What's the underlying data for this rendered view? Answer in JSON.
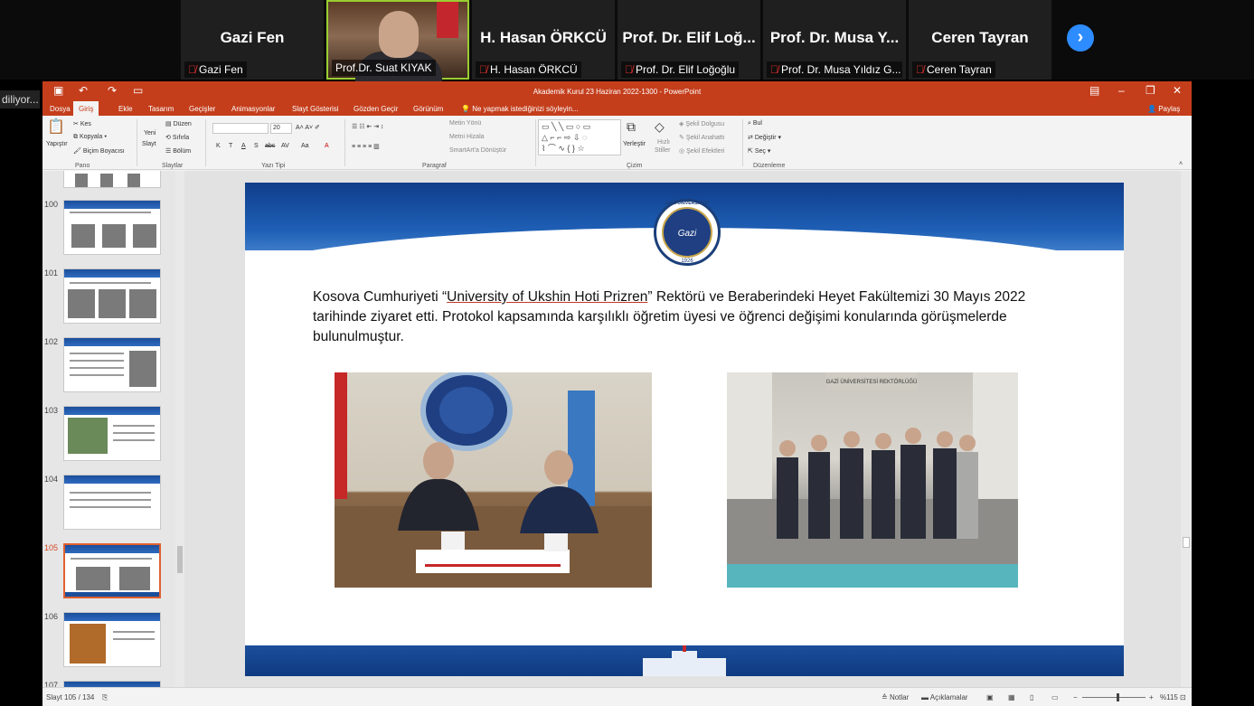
{
  "zoom_meeting": {
    "participants": [
      {
        "tile_name": "Gazi Fen",
        "label": "Gazi Fen",
        "muted": true
      },
      {
        "tile_name": "",
        "label": "Prof.Dr. Suat KIYAK",
        "muted": false,
        "active_speaker": true
      },
      {
        "tile_name": "H. Hasan ÖRKCÜ",
        "label": "H. Hasan ÖRKCÜ",
        "muted": true
      },
      {
        "tile_name": "Prof. Dr. Elif Loğ...",
        "label": "Prof. Dr. Elif Loğoğlu",
        "muted": true
      },
      {
        "tile_name": "Prof. Dr. Musa Y...",
        "label": "Prof. Dr. Musa Yıldız G...",
        "muted": true
      },
      {
        "tile_name": "Ceren Tayran",
        "label": "Ceren Tayran",
        "muted": true
      }
    ],
    "next_icon": "chevron-right-icon",
    "sharing_label": "diliyor..."
  },
  "powerpoint": {
    "window_title": "Akademik Kurul 23 Haziran 2022-1300 - PowerPoint",
    "tabs": [
      "Dosya",
      "Giriş",
      "Ekle",
      "Tasarım",
      "Geçişler",
      "Animasyonlar",
      "Slayt Gösterisi",
      "Gözden Geçir",
      "Görünüm"
    ],
    "active_tab": "Giriş",
    "tell_me": "Ne yapmak istediğinizi söyleyin...",
    "share": "Paylaş",
    "ribbon": {
      "pano": {
        "paste": "Yapıştır",
        "cut": "Kes",
        "copy": "Kopyala",
        "format_painter": "Biçim Boyacısı",
        "group": "Pano"
      },
      "slaytlar": {
        "new_slide_1": "Yeni",
        "new_slide_2": "Slayt",
        "layout": "Düzen",
        "reset": "Sıfırla",
        "section": "Bölüm",
        "group": "Slaytlar"
      },
      "yazi_tipi": {
        "size": "20",
        "group": "Yazı Tipi",
        "b": "K",
        "i": "T",
        "u": "A",
        "s": "S",
        "abc": "abc",
        "av": "AV",
        "aa": "Aa"
      },
      "paragraf": {
        "direction": "Metin Yönü",
        "align": "Metni Hizala",
        "smartart": "SmartArt'a Dönüştür",
        "group": "Paragraf"
      },
      "cizim": {
        "arrange": "Yerleştir",
        "quick_styles_1": "Hızlı",
        "quick_styles_2": "Stiller",
        "fill": "Şekil Dolgusu",
        "outline": "Şekil Anahattı",
        "effects": "Şekil Efektleri",
        "group": "Çizim"
      },
      "duzenleme": {
        "find": "Bul",
        "replace": "Değiştir",
        "select": "Seç",
        "group": "Düzenleme"
      }
    },
    "thumbnails": [
      {
        "num": "100",
        "selected": false
      },
      {
        "num": "101",
        "selected": false
      },
      {
        "num": "102",
        "selected": false
      },
      {
        "num": "103",
        "selected": false
      },
      {
        "num": "104",
        "selected": false
      },
      {
        "num": "105",
        "selected": true
      },
      {
        "num": "106",
        "selected": false
      },
      {
        "num": "107",
        "selected": false
      }
    ],
    "slide": {
      "seal_ring": "GAZİ ÜNİVERSİTESİ",
      "seal_center": "Gazi",
      "seal_year": "1926",
      "text_before": "Kosova Cumhuriyeti “",
      "text_underlined": "University of Ukshin Hoti Prizren",
      "text_after": "” Rektörü ve Beraberindeki Heyet Fakültemizi 30 Mayıs 2022 tarihinde ziyaret etti. Protokol kapsamında karşılıklı öğretim üyesi ve öğrenci değişimi konularında görüşmelerde bulunulmuştur.",
      "photo2_sign": "GAZİ ÜNİVERSİTESİ REKTÖRLÜĞÜ"
    },
    "statusbar": {
      "slide_info": "Slayt 105 / 134",
      "notes": "Notlar",
      "comments": "Açıklamalar",
      "zoom": "%115",
      "zoom_level": 0.55
    }
  }
}
